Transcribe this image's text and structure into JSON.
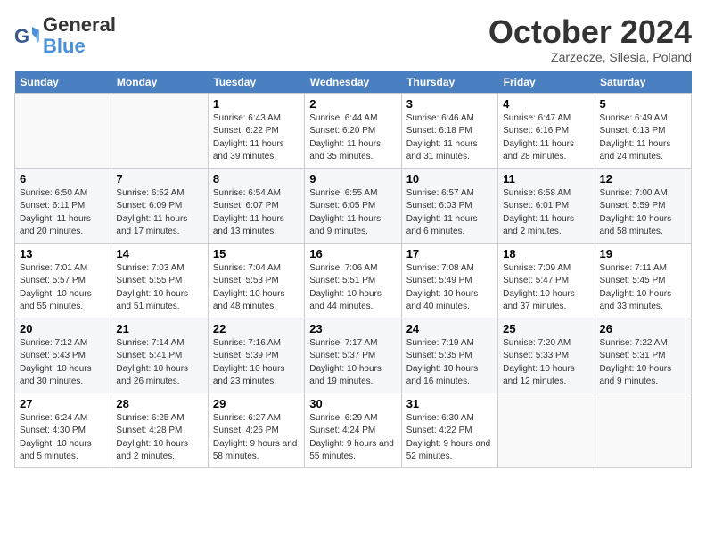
{
  "header": {
    "logo_line1": "General",
    "logo_line2": "Blue",
    "month": "October 2024",
    "location": "Zarzecze, Silesia, Poland"
  },
  "columns": [
    "Sunday",
    "Monday",
    "Tuesday",
    "Wednesday",
    "Thursday",
    "Friday",
    "Saturday"
  ],
  "weeks": [
    [
      {
        "day": "",
        "detail": ""
      },
      {
        "day": "",
        "detail": ""
      },
      {
        "day": "1",
        "detail": "Sunrise: 6:43 AM\nSunset: 6:22 PM\nDaylight: 11 hours and 39 minutes."
      },
      {
        "day": "2",
        "detail": "Sunrise: 6:44 AM\nSunset: 6:20 PM\nDaylight: 11 hours and 35 minutes."
      },
      {
        "day": "3",
        "detail": "Sunrise: 6:46 AM\nSunset: 6:18 PM\nDaylight: 11 hours and 31 minutes."
      },
      {
        "day": "4",
        "detail": "Sunrise: 6:47 AM\nSunset: 6:16 PM\nDaylight: 11 hours and 28 minutes."
      },
      {
        "day": "5",
        "detail": "Sunrise: 6:49 AM\nSunset: 6:13 PM\nDaylight: 11 hours and 24 minutes."
      }
    ],
    [
      {
        "day": "6",
        "detail": "Sunrise: 6:50 AM\nSunset: 6:11 PM\nDaylight: 11 hours and 20 minutes."
      },
      {
        "day": "7",
        "detail": "Sunrise: 6:52 AM\nSunset: 6:09 PM\nDaylight: 11 hours and 17 minutes."
      },
      {
        "day": "8",
        "detail": "Sunrise: 6:54 AM\nSunset: 6:07 PM\nDaylight: 11 hours and 13 minutes."
      },
      {
        "day": "9",
        "detail": "Sunrise: 6:55 AM\nSunset: 6:05 PM\nDaylight: 11 hours and 9 minutes."
      },
      {
        "day": "10",
        "detail": "Sunrise: 6:57 AM\nSunset: 6:03 PM\nDaylight: 11 hours and 6 minutes."
      },
      {
        "day": "11",
        "detail": "Sunrise: 6:58 AM\nSunset: 6:01 PM\nDaylight: 11 hours and 2 minutes."
      },
      {
        "day": "12",
        "detail": "Sunrise: 7:00 AM\nSunset: 5:59 PM\nDaylight: 10 hours and 58 minutes."
      }
    ],
    [
      {
        "day": "13",
        "detail": "Sunrise: 7:01 AM\nSunset: 5:57 PM\nDaylight: 10 hours and 55 minutes."
      },
      {
        "day": "14",
        "detail": "Sunrise: 7:03 AM\nSunset: 5:55 PM\nDaylight: 10 hours and 51 minutes."
      },
      {
        "day": "15",
        "detail": "Sunrise: 7:04 AM\nSunset: 5:53 PM\nDaylight: 10 hours and 48 minutes."
      },
      {
        "day": "16",
        "detail": "Sunrise: 7:06 AM\nSunset: 5:51 PM\nDaylight: 10 hours and 44 minutes."
      },
      {
        "day": "17",
        "detail": "Sunrise: 7:08 AM\nSunset: 5:49 PM\nDaylight: 10 hours and 40 minutes."
      },
      {
        "day": "18",
        "detail": "Sunrise: 7:09 AM\nSunset: 5:47 PM\nDaylight: 10 hours and 37 minutes."
      },
      {
        "day": "19",
        "detail": "Sunrise: 7:11 AM\nSunset: 5:45 PM\nDaylight: 10 hours and 33 minutes."
      }
    ],
    [
      {
        "day": "20",
        "detail": "Sunrise: 7:12 AM\nSunset: 5:43 PM\nDaylight: 10 hours and 30 minutes."
      },
      {
        "day": "21",
        "detail": "Sunrise: 7:14 AM\nSunset: 5:41 PM\nDaylight: 10 hours and 26 minutes."
      },
      {
        "day": "22",
        "detail": "Sunrise: 7:16 AM\nSunset: 5:39 PM\nDaylight: 10 hours and 23 minutes."
      },
      {
        "day": "23",
        "detail": "Sunrise: 7:17 AM\nSunset: 5:37 PM\nDaylight: 10 hours and 19 minutes."
      },
      {
        "day": "24",
        "detail": "Sunrise: 7:19 AM\nSunset: 5:35 PM\nDaylight: 10 hours and 16 minutes."
      },
      {
        "day": "25",
        "detail": "Sunrise: 7:20 AM\nSunset: 5:33 PM\nDaylight: 10 hours and 12 minutes."
      },
      {
        "day": "26",
        "detail": "Sunrise: 7:22 AM\nSunset: 5:31 PM\nDaylight: 10 hours and 9 minutes."
      }
    ],
    [
      {
        "day": "27",
        "detail": "Sunrise: 6:24 AM\nSunset: 4:30 PM\nDaylight: 10 hours and 5 minutes."
      },
      {
        "day": "28",
        "detail": "Sunrise: 6:25 AM\nSunset: 4:28 PM\nDaylight: 10 hours and 2 minutes."
      },
      {
        "day": "29",
        "detail": "Sunrise: 6:27 AM\nSunset: 4:26 PM\nDaylight: 9 hours and 58 minutes."
      },
      {
        "day": "30",
        "detail": "Sunrise: 6:29 AM\nSunset: 4:24 PM\nDaylight: 9 hours and 55 minutes."
      },
      {
        "day": "31",
        "detail": "Sunrise: 6:30 AM\nSunset: 4:22 PM\nDaylight: 9 hours and 52 minutes."
      },
      {
        "day": "",
        "detail": ""
      },
      {
        "day": "",
        "detail": ""
      }
    ]
  ]
}
